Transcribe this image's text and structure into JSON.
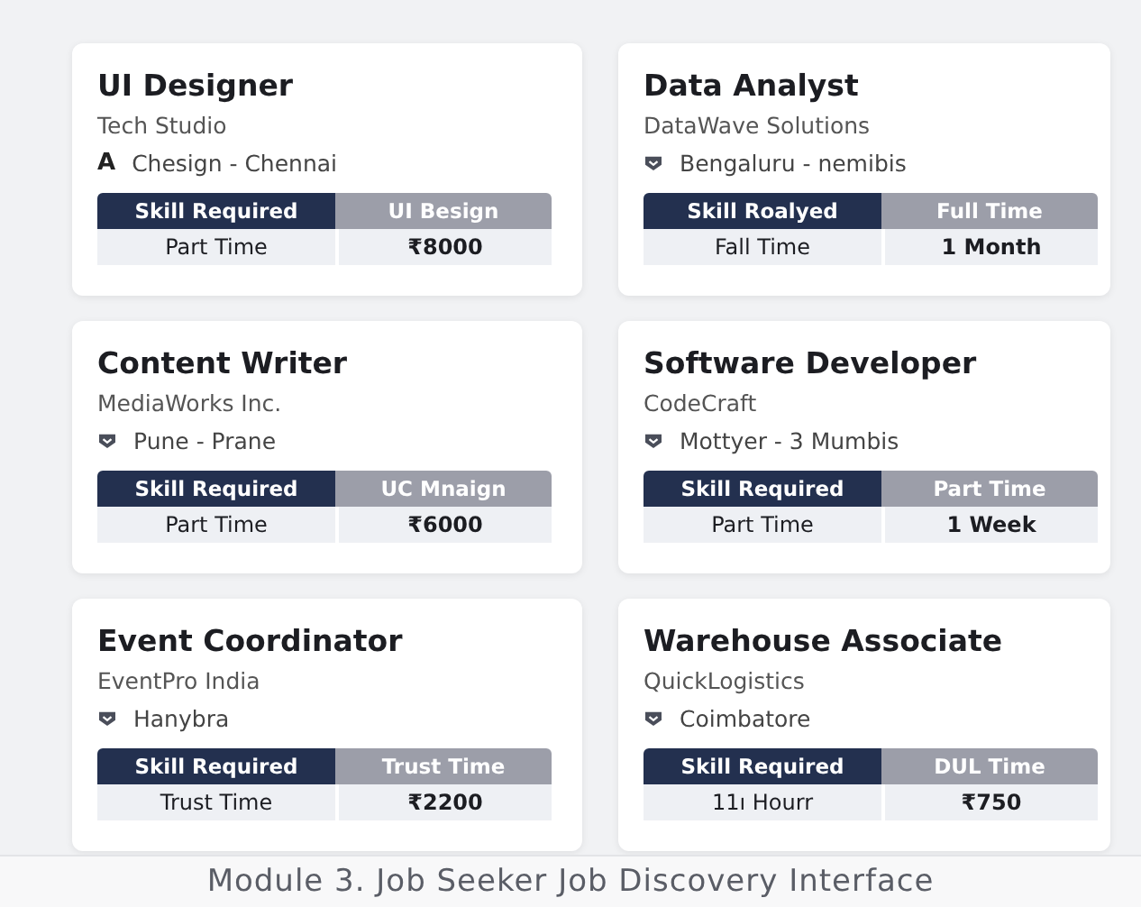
{
  "jobs": [
    {
      "title": "UI Designer",
      "company": "Tech Studio",
      "location_icon": {
        "kind": "letter",
        "text": "A"
      },
      "location": "Chesign - Chennai",
      "header": [
        "Skill Required",
        "UI Besign"
      ],
      "row": [
        "Part Time",
        "₹8000"
      ]
    },
    {
      "title": "Data Analyst",
      "company": "DataWave Solutions",
      "location_icon": {
        "kind": "pin"
      },
      "location": "Bengaluru - nemibis",
      "header": [
        "Skill Roalyed",
        "Full Time"
      ],
      "row": [
        "Fall Time",
        "1 Month"
      ]
    },
    {
      "title": "Content Writer",
      "company": "MediaWorks Inc.",
      "location_icon": {
        "kind": "pin"
      },
      "location": "Pune - Prane",
      "header": [
        "Skill Required",
        "UC Mnaign"
      ],
      "row": [
        "Part Time",
        "₹6000"
      ]
    },
    {
      "title": "Software Developer",
      "company": "CodeCraft",
      "location_icon": {
        "kind": "pin"
      },
      "location": "Mottyer - 3 Mumbis",
      "header": [
        "Skill Required",
        "Part Time"
      ],
      "row": [
        "Part Time",
        "1 Week"
      ]
    },
    {
      "title": "Event Coordinator",
      "company": "EventPro India",
      "location_icon": {
        "kind": "pin"
      },
      "location": "Hanybra",
      "header": [
        "Skill Required",
        "Trust Time"
      ],
      "row": [
        "Trust Time",
        "₹2200"
      ]
    },
    {
      "title": "Warehouse Associate",
      "company": "QuickLogistics",
      "location_icon": {
        "kind": "pin"
      },
      "location": "Coimbatore",
      "header": [
        "Skill Required",
        "DUL Time"
      ],
      "row": [
        "11ı Hourr",
        "₹750"
      ]
    }
  ],
  "caption": "Module 3. Job Seeker Job Discovery Interface"
}
